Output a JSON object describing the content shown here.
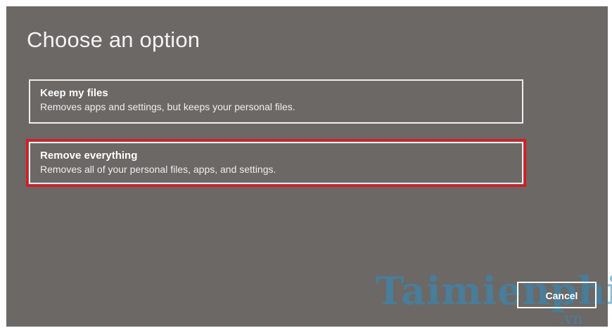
{
  "page": {
    "title": "Choose an option"
  },
  "options": [
    {
      "title": "Keep my files",
      "description": "Removes apps and settings, but keeps your personal files."
    },
    {
      "title": "Remove everything",
      "description": "Removes all of your personal files, apps, and settings.",
      "highlighted": true
    }
  ],
  "buttons": {
    "cancel_label": "Cancel"
  },
  "watermark": {
    "brand": "Taimienphi",
    "suffix": ".vn"
  },
  "colors": {
    "background": "#6b6866",
    "highlight": "#e8141c",
    "watermark": "#2e8fc3"
  }
}
